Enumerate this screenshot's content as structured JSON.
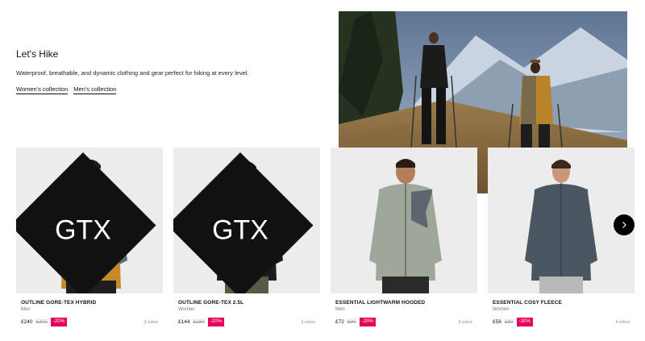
{
  "hero": {
    "title": "Let's Hike",
    "subtitle": "Waterproof, breathable, and dynamic clothing and gear perfect for hiking at every level.",
    "links": [
      "Women's collection",
      "Men's collection"
    ]
  },
  "products": [
    {
      "name": "OUTLINE GORE-TEX HYBRID",
      "gender": "Men",
      "price": "£240",
      "old_price": "£300",
      "discount": "-20%",
      "colors": "3 colors",
      "gore_tex": true,
      "jacket_color": "#c48a28",
      "shoulder_color": "#5d6b78"
    },
    {
      "name": "OUTLINE GORE-TEX 2.5L",
      "gender": "Women",
      "price": "£144",
      "old_price": "£180",
      "discount": "-20%",
      "colors": "3 colors",
      "gore_tex": true,
      "jacket_color": "#1c1c1c",
      "shoulder_color": "#1c1c1c"
    },
    {
      "name": "ESSENTIAL LIGHTWARM HOODED",
      "gender": "Men",
      "price": "£72",
      "old_price": "£90",
      "discount": "-20%",
      "colors": "3 colors",
      "gore_tex": false,
      "jacket_color": "#9ea79a",
      "shoulder_color": "#5c6670"
    },
    {
      "name": "ESSENTIAL COSY FLEECE",
      "gender": "Women",
      "price": "£56",
      "old_price": "£80",
      "discount": "-30%",
      "colors": "4 colors",
      "gore_tex": false,
      "jacket_color": "#4b5663",
      "shoulder_color": "#4b5663"
    }
  ],
  "icons": {
    "next": "chevron-right-icon",
    "badge": "gore-tex-logo-icon"
  },
  "colors": {
    "accent_discount": "#e8005a",
    "text": "#111111"
  }
}
